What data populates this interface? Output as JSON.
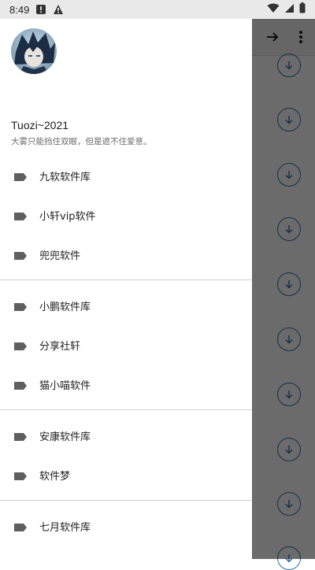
{
  "status_bar": {
    "time": "8:49",
    "icons": [
      "alert-icon",
      "notification-a-icon",
      "wifi-icon",
      "signal-icon",
      "battery-icon"
    ]
  },
  "app_toolbar": {
    "forward_icon": "arrow-right-icon",
    "more_icon": "more-vert-icon"
  },
  "drawer": {
    "user": {
      "name": "Tuozi~2021",
      "subtitle": "大雾只能挡住双眼，但是遮不住爱意。"
    },
    "groups": [
      [
        {
          "label": "九软软件库",
          "icon": "label-icon"
        },
        {
          "label": "小轩vip软件",
          "icon": "label-icon"
        },
        {
          "label": "兜兜软件",
          "icon": "label-icon"
        }
      ],
      [
        {
          "label": "小鹏软件库",
          "icon": "label-icon"
        },
        {
          "label": "分享社轩",
          "icon": "label-icon"
        },
        {
          "label": "猫小喵软件",
          "icon": "label-icon"
        }
      ],
      [
        {
          "label": "安康软件库",
          "icon": "label-icon"
        },
        {
          "label": "软件梦",
          "icon": "label-icon"
        }
      ],
      [
        {
          "label": "七月软件库",
          "icon": "label-icon"
        }
      ]
    ]
  },
  "colors": {
    "accent": "#2b6fb6",
    "tag_icon": "#5f5f5f",
    "divider": "#cfcfcf"
  }
}
